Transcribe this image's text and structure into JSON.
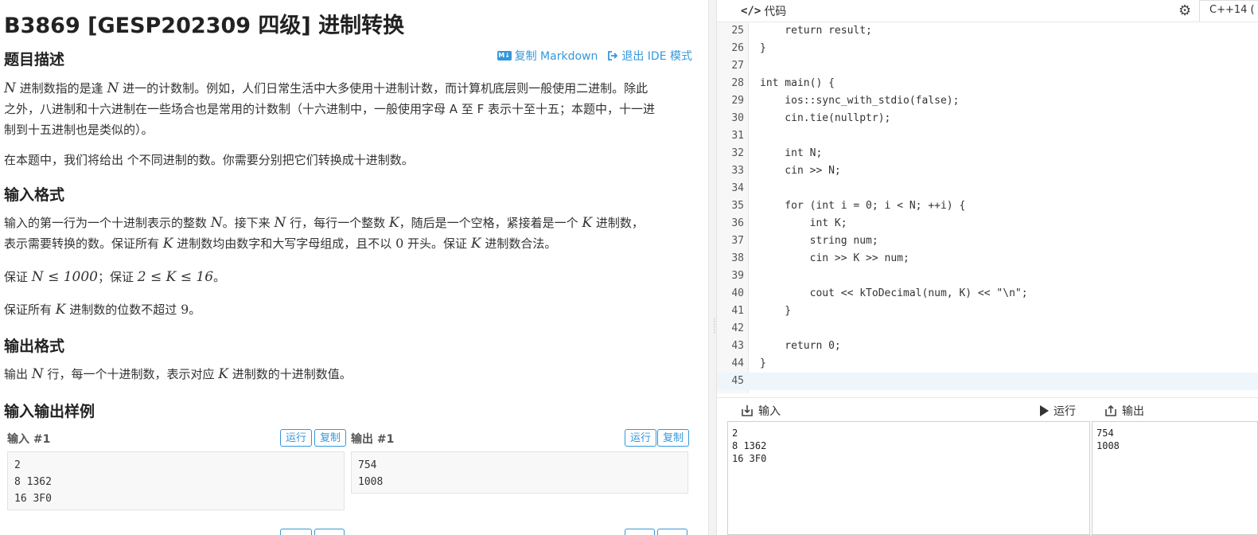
{
  "problem": {
    "title": "B3869 [GESP202309 四级] 进制转换",
    "links": {
      "copy_markdown": "复制 Markdown",
      "exit_ide": "退出 IDE 模式",
      "md_badge": "M↓"
    },
    "desc_heading": "题目描述",
    "desc_p1_l1_a": "进制数指的是逢",
    "desc_p1_l1_b": "进一的计数制。例如，人们日常生活中大多使用十进制计数，而计算机底层则一般使用二进制。除此",
    "desc_p1_l2": "之外，八进制和十六进制在一些场合也是常用的计数制（十六进制中，一般使用字母 A 至 F 表示十至十五；本题中，十一进",
    "desc_p1_l3": "制到十五进制也是类似的）。",
    "desc_p2": "在本题中，我们将给出 个不同进制的数。你需要分别把它们转换成十进制数。",
    "input_heading": "输入格式",
    "in_l1_a": "输入的第一行为一个十进制表示的整数",
    "in_l1_b": "。接下来",
    "in_l1_c": "行，每行一个整数",
    "in_l1_d": "，随后是一个空格，紧接着是一个",
    "in_l1_e": "进制数，",
    "in_l2_a": "表示需要转换的数。保证所有",
    "in_l2_b": "进制数均由数字和大写字母组成，且不以",
    "in_l2_c": "开头。保证",
    "in_l2_d": "进制数合法。",
    "constraint1_a": "保证",
    "constraint1_b": "；保证",
    "constraint1_c": "。",
    "constraint2_a": "保证所有",
    "constraint2_b": "进制数的位数不超过",
    "constraint2_c": "。",
    "output_heading": "输出格式",
    "out_a": "输出",
    "out_b": "行，每一个十进制数，表示对应",
    "out_c": "进制数的十进制数值。",
    "sample_heading": "输入输出样例",
    "math": {
      "N": "N",
      "K": "K",
      "zero": "0",
      "nine": "9",
      "n_le": "N ≤ 1000",
      "k_range": "2 ≤ K ≤ 16"
    },
    "samples": {
      "input_label": "输入 #1",
      "output_label": "输出 #1",
      "run": "运行",
      "copy": "复制",
      "input_lines": [
        "2",
        "8 1362",
        "16 3F0"
      ],
      "output_lines": [
        "754",
        "1008"
      ]
    }
  },
  "ide": {
    "code_tab": "代码",
    "code_tab_icon": "</>",
    "lang": "C++14 (",
    "gear_icon": "⚙",
    "code_lines": [
      {
        "n": "25",
        "t": "    return result;"
      },
      {
        "n": "26",
        "t": "}"
      },
      {
        "n": "27",
        "t": ""
      },
      {
        "n": "28",
        "t": "int main() {"
      },
      {
        "n": "29",
        "t": "    ios::sync_with_stdio(false);"
      },
      {
        "n": "30",
        "t": "    cin.tie(nullptr);"
      },
      {
        "n": "31",
        "t": ""
      },
      {
        "n": "32",
        "t": "    int N;"
      },
      {
        "n": "33",
        "t": "    cin >> N;"
      },
      {
        "n": "34",
        "t": ""
      },
      {
        "n": "35",
        "t": "    for (int i = 0; i < N; ++i) {"
      },
      {
        "n": "36",
        "t": "        int K;"
      },
      {
        "n": "37",
        "t": "        string num;"
      },
      {
        "n": "38",
        "t": "        cin >> K >> num;"
      },
      {
        "n": "39",
        "t": ""
      },
      {
        "n": "40",
        "t": "        cout << kToDecimal(num, K) << \"\\n\";"
      },
      {
        "n": "41",
        "t": "    }"
      },
      {
        "n": "42",
        "t": ""
      },
      {
        "n": "43",
        "t": "    return 0;"
      },
      {
        "n": "44",
        "t": "}"
      },
      {
        "n": "45",
        "t": ""
      }
    ],
    "input_tab": "输入",
    "run_tab": "运行",
    "output_tab": "输出",
    "input_lines": [
      "2",
      "8 1362",
      "16 3F0"
    ],
    "output_lines": [
      "754",
      "1008"
    ]
  }
}
